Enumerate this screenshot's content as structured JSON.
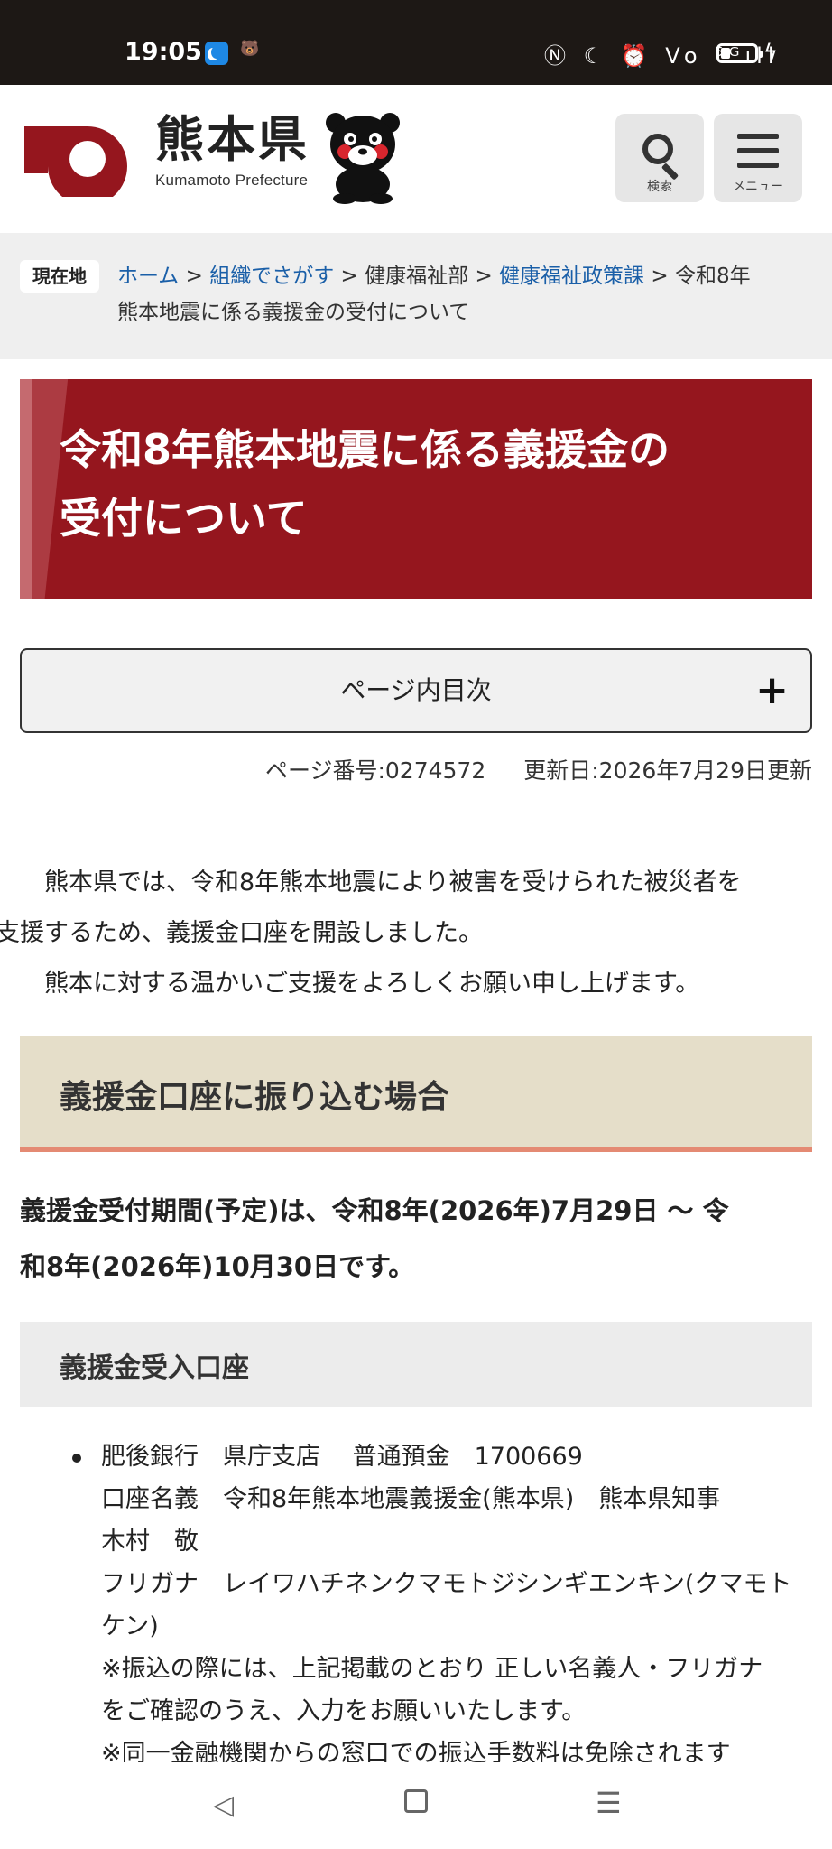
{
  "status_bar": {
    "time": "19:05",
    "app_icon2_text": "🐻",
    "right_icons": "Ⓝ ☾ ⏰ Vo ⁵ᴳıll",
    "bolt": "ϟ"
  },
  "header": {
    "logo_jp": "熊本県",
    "logo_en": "Kumamoto Prefecture",
    "search_caption": "検索",
    "menu_caption": "メニュー",
    "brand_color": "#95161e"
  },
  "breadcrumb": {
    "label": "現在地",
    "items": [
      "ホーム",
      "組織でさがす",
      "健康福祉部",
      "健康福祉政策課"
    ],
    "separator": ">",
    "current_line1": "令和8年",
    "current_line2": "熊本地震に係る義援金の受付について"
  },
  "title": {
    "line1": "令和8年熊本地震に係る義援金の",
    "line2": "受付について"
  },
  "toc": {
    "label": "ページ内目次",
    "toggle": "+"
  },
  "meta": {
    "page_number": "ページ番号:0274572",
    "updated": "更新日:2026年7月29日更新"
  },
  "intro": {
    "line1": "熊本県では、令和8年熊本地震により被害を受けられた被災者を",
    "line2": "支援するため、義援金口座を開設しました。",
    "line3": "熊本に対する温かいご支援をよろしくお願い申し上げます。"
  },
  "section_heading": "義援金口座に振り込む場合",
  "period": {
    "line1": "義援金受付期間(予定)は、令和8年(2026年)7月29日 〜 令",
    "line2": "和8年(2026年)10月30日です。"
  },
  "sub_heading": "義援金受入口座",
  "account": {
    "lines": [
      "肥後銀行　県庁支店　 普通預金　1700669",
      "口座名義　令和8年熊本地震義援金(熊本県)　熊本県知事",
      "木村　敬",
      "フリガナ　レイワハチネンクマモトジシンギエンキン(クマモト",
      "ケン)",
      "※振込の際には、上記掲載のとおり 正しい名義人・フリガナ",
      "をご確認のうえ、入力をお願いいたします。",
      "※同一金融機関からの窓口での振込手数料は免除されます"
    ]
  },
  "nav": {
    "back": "◁",
    "menu": "☰"
  }
}
